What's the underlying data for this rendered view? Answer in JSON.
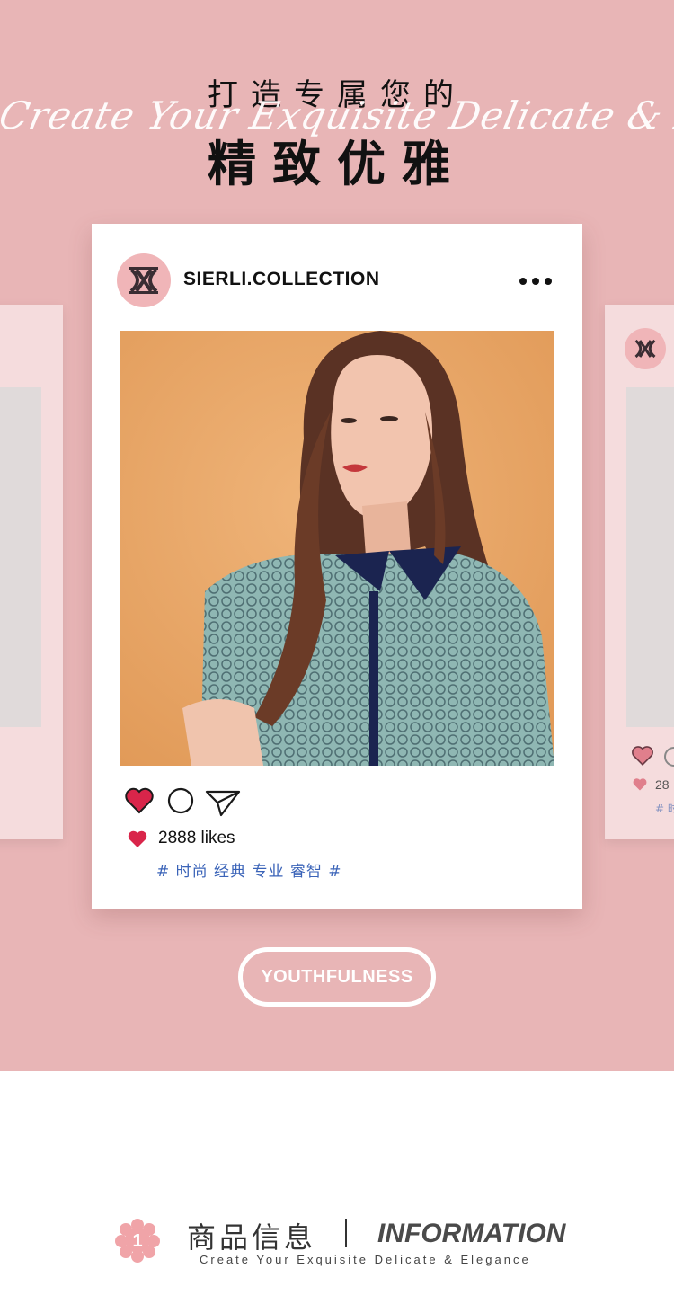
{
  "header": {
    "title_line1": "打造专属您的",
    "title_line2": "精致优雅",
    "script_overlay": "Create Your Exquisite Delicate & Elegance"
  },
  "post": {
    "username": "SIERLI.COLLECTION",
    "likes_text": "2888 likes",
    "hashtags": "# 时尚 经典 专业 睿智 #",
    "liked": true
  },
  "side_card_right": {
    "likes_partial": "28",
    "tag_partial": "# 时"
  },
  "cta": {
    "label": "YOUTHFULNESS"
  },
  "info": {
    "number": "1",
    "title_cn": "商品信息",
    "title_en": "INFORMATION",
    "subtitle": "Create Your Exquisite Delicate & Elegance"
  },
  "icons": [
    "more-icon",
    "heart-icon",
    "comment-icon",
    "share-icon",
    "brand-logo-icon"
  ],
  "colors": {
    "hero_background": "#e8b5b6",
    "accent_pink": "#f0b5b8",
    "heart_red": "#d9254a",
    "hashtag_blue": "#3a63b8"
  }
}
